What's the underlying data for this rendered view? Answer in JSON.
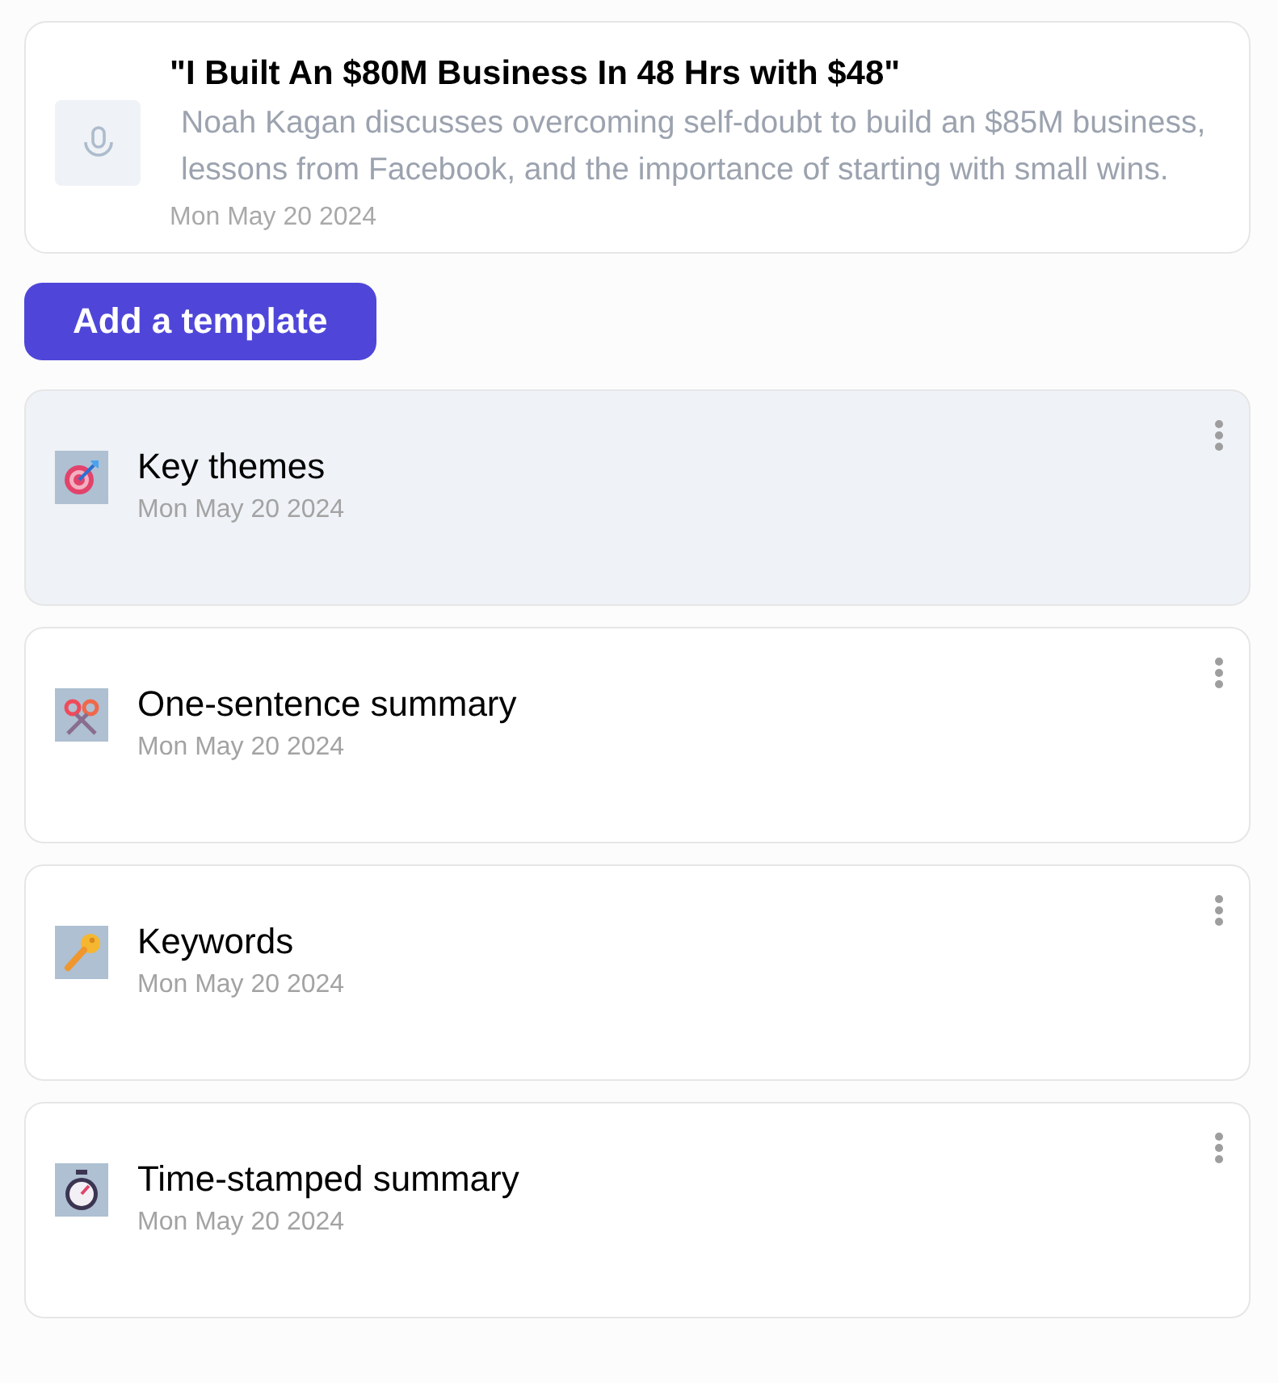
{
  "episode": {
    "title": "\"I Built An $80M Business In 48 Hrs with $48\"",
    "description": "Noah Kagan discusses overcoming self-doubt to build an $85M business, lessons from Facebook, and the importance of starting with small wins.",
    "date": "Mon May 20 2024"
  },
  "add_button": {
    "label": "Add a template"
  },
  "templates": [
    {
      "title": "Key themes",
      "date": "Mon May 20 2024",
      "kind": "target",
      "selected": true
    },
    {
      "title": "One-sentence summary",
      "date": "Mon May 20 2024",
      "kind": "scissors",
      "selected": false
    },
    {
      "title": "Keywords",
      "date": "Mon May 20 2024",
      "kind": "key",
      "selected": false
    },
    {
      "title": "Time-stamped summary",
      "date": "Mon May 20 2024",
      "kind": "stopwatch",
      "selected": false
    }
  ]
}
